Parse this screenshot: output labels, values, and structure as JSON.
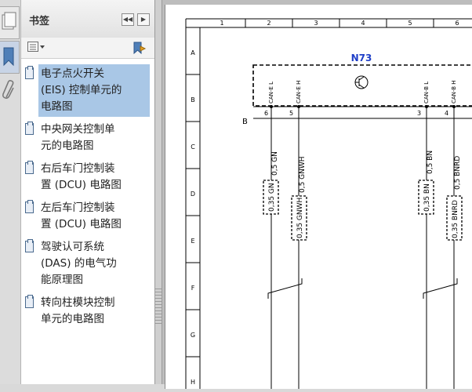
{
  "bookmarks_panel": {
    "title": "书签",
    "items": [
      {
        "label": "电子点火开关 (EIS) 控制单元的电路图",
        "lines": [
          "电子点火开关",
          "(EIS) 控制单元的",
          "电路图"
        ],
        "selected": true
      },
      {
        "label": "中央网关控制单元的电路图",
        "lines": [
          "中央网关控制单",
          "元的电路图"
        ],
        "selected": false
      },
      {
        "label": "右后车门控制装置 (DCU) 电路图",
        "lines": [
          "右后车门控制装",
          "置 (DCU) 电路图"
        ],
        "selected": false
      },
      {
        "label": "左后车门控制装置 (DCU) 电路图",
        "lines": [
          "左后车门控制装",
          "置 (DCU) 电路图"
        ],
        "selected": false
      },
      {
        "label": "驾驶认可系统 (DAS) 的电气功能原理图",
        "lines": [
          "驾驶认可系统",
          "(DAS) 的电气功",
          "能原理图"
        ],
        "selected": false
      },
      {
        "label": "转向柱模块控制单元的电路图",
        "lines": [
          "转向柱模块控制",
          "单元的电路图"
        ],
        "selected": false
      }
    ]
  },
  "icons": {
    "collapse": "double-left-arrow-icon",
    "expand": "right-arrow-icon",
    "options": "options-menu-icon",
    "find_bookmark": "find-bookmark-icon",
    "pages_tab": "pages-icon",
    "bookmarks_tab": "bookmark-icon",
    "attachments_tab": "paperclip-icon"
  },
  "diagram": {
    "column_labels": [
      "1",
      "2",
      "3",
      "4",
      "5",
      "6"
    ],
    "row_labels": [
      "A",
      "B",
      "C",
      "D",
      "E",
      "F",
      "G",
      "H"
    ],
    "component": "N73",
    "side_label": "B",
    "pins": [
      {
        "name": "CAN-E L",
        "number": "6"
      },
      {
        "name": "CAN-E H",
        "number": "5"
      },
      {
        "name": "CAN-B L",
        "number": "3"
      },
      {
        "name": "CAN-B H",
        "number": "4"
      }
    ],
    "wires": [
      "0,5 GN",
      "0,5 GNWH",
      "0,5 BN",
      "0,5 BNRD"
    ],
    "connectors": [
      "0,35 GN",
      "0,35 GNWH",
      "0,35 BN",
      "0,35 BNRD"
    ]
  },
  "colors": {
    "selection": "#a9c7e6",
    "component_label": "#1f3fc8"
  }
}
